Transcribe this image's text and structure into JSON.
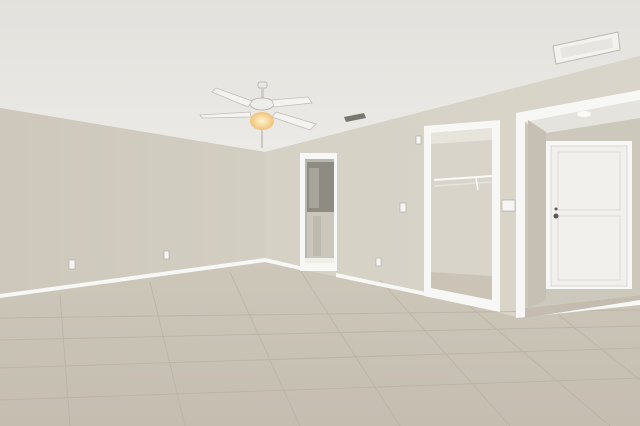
{
  "scene": {
    "colors": {
      "ceiling": "#e6e4df",
      "wall_left": "#cfcabd",
      "wall_back": "#d6d2c6",
      "floor": "#c9c2b5",
      "trim": "#f7f7f5",
      "door": "#f1f0ec",
      "light_glow": "#f6d9a0"
    },
    "icons": [
      "ceiling-fan-icon",
      "door-icon",
      "closet-rod-icon",
      "outlet-icon",
      "light-switch-icon",
      "air-vent-icon",
      "recessed-light-icon"
    ]
  }
}
